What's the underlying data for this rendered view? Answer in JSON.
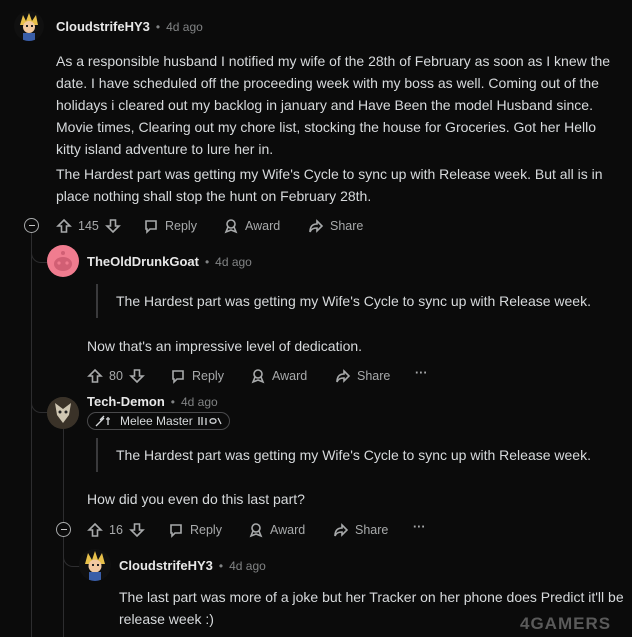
{
  "comment1": {
    "username": "CloudstrifeHY3",
    "time": "4d ago",
    "paragraph1": "As a responsible husband I notified my wife of the 28th of February as soon as I knew the date. I have scheduled off the proceeding week with my boss as well. Coming out of the holidays i cleared out my backlog in january and Have Been the model Husband since. Movie times, Clearing out my chore list, stocking the house for Groceries. Got her Hello kitty island adventure to lure her in.",
    "paragraph2": "The Hardest part was getting my Wife's Cycle to sync up with Release week. But all is in place nothing shall stop the hunt on February 28th.",
    "votes": "145",
    "reply": "Reply",
    "award": "Award",
    "share": "Share"
  },
  "comment2": {
    "username": "TheOldDrunkGoat",
    "time": "4d ago",
    "quote": "The Hardest part was getting my Wife's Cycle to sync up with Release week.",
    "text": "Now that's an impressive level of dedication.",
    "votes": "80",
    "reply": "Reply",
    "award": "Award",
    "share": "Share",
    "more": "···"
  },
  "comment3": {
    "username": "Tech-Demon",
    "time": "4d ago",
    "flair": "Melee Master",
    "quote": "The Hardest part was getting my Wife's Cycle to sync up with Release week.",
    "text": "How did you even do this last part?",
    "votes": "16",
    "reply": "Reply",
    "award": "Award",
    "share": "Share",
    "more": "···"
  },
  "comment4": {
    "username": "CloudstrifeHY3",
    "time": "4d ago",
    "text": "The last part was more of a joke but her Tracker on her phone does Predict it'll be release week :)"
  },
  "meta_separator": "•",
  "watermark": "4GAMERS"
}
